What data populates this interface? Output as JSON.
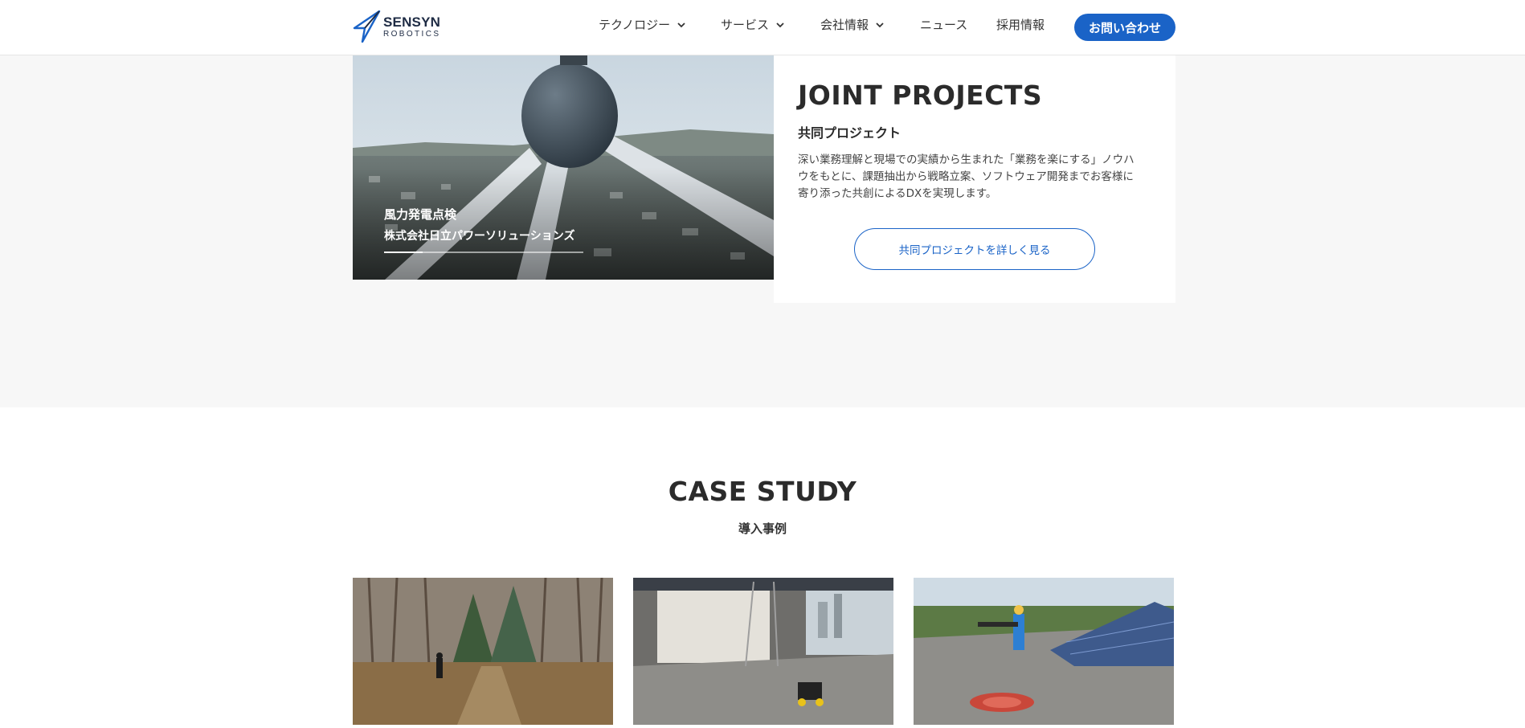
{
  "header": {
    "logo": {
      "main": "SENSYN",
      "sub": "ROBOTICS"
    },
    "nav": [
      {
        "label": "テクノロジー",
        "has_dropdown": true
      },
      {
        "label": "サービス",
        "has_dropdown": true
      },
      {
        "label": "会社情報",
        "has_dropdown": true
      },
      {
        "label": "ニュース",
        "has_dropdown": false
      },
      {
        "label": "採用情報",
        "has_dropdown": false
      }
    ],
    "contact_label": "お問い合わせ"
  },
  "joint_projects": {
    "slide": {
      "title": "風力発電点検",
      "company": "株式会社日立パワーソリューションズ"
    },
    "title": "JOINT PROJECTS",
    "subtitle": "共同プロジェクト",
    "description_lines": [
      "深い業務理解と現場での実績から生まれた「業務を楽にする」ノウハ",
      "ウをもとに、課題抽出から戦略立案、ソフトウェア開発までお客様に",
      "寄り添った共創によるDXを実現します。"
    ],
    "button_label": "共同プロジェクトを詳しく見る"
  },
  "case_study": {
    "title": "CASE STUDY",
    "subtitle": "導入事例"
  },
  "colors": {
    "accent": "#1a63c7",
    "section_bg": "#f7f7f7",
    "text": "#2b2b2b"
  }
}
